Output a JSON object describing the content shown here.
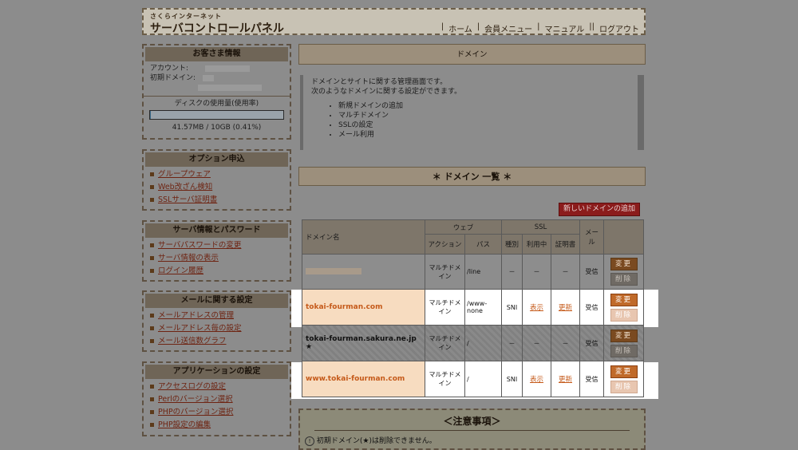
{
  "header": {
    "logo_small": "さくらインターネット",
    "logo_big": "サーバコントロールパネル",
    "nav": [
      "ホーム",
      "会員メニュー",
      "マニュアル",
      "ログアウト"
    ]
  },
  "customer": {
    "title": "お客さま情報",
    "account_label": "アカウント:",
    "domain_label": "初期ドメイン:",
    "disk_title": "ディスクの使用量(使用率)",
    "disk_usage": "41.57MB / 10GB (0.41%)",
    "disk_percent": 0.41
  },
  "options": {
    "title": "オプション申込",
    "items": [
      "グループウェア",
      "Web改ざん検知",
      "SSLサーバ証明書"
    ]
  },
  "server_info": {
    "title": "サーバ情報とパスワード",
    "items": [
      "サーバパスワードの変更",
      "サーバ情報の表示",
      "ログイン履歴"
    ]
  },
  "mail": {
    "title": "メールに関する設定",
    "items": [
      "メールアドレスの管理",
      "メールアドレス毎の設定",
      "メール送信数グラフ"
    ]
  },
  "apps": {
    "title": "アプリケーションの設定",
    "items": [
      "アクセスログの設定",
      "Perlのバージョン選択",
      "PHPのバージョン選択",
      "PHP設定の編集"
    ]
  },
  "main": {
    "section_title": "ドメイン",
    "desc_line1": "ドメインとサイトに関する管理画面です。",
    "desc_line2": "次のようなドメインに関する設定ができます。",
    "features": [
      "新規ドメインの追加",
      "マルチドメイン",
      "SSLの設定",
      "メール利用"
    ],
    "list_title": "＊ ドメイン 一覧 ＊",
    "add_button": "新しいドメインの追加",
    "notice_title": "＜注意事項＞",
    "notice_text": "初期ドメイン(★)は削除できません。"
  },
  "table": {
    "h_domain": "ドメイン名",
    "h_web": "ウェブ",
    "h_ssl": "SSL",
    "h_mail": "メール",
    "h_action": "アクション",
    "h_path": "パス",
    "h_type": "種別",
    "h_use": "利用中",
    "h_cert": "証明書",
    "btn_edit": "変更",
    "btn_del": "削除",
    "rows": [
      {
        "domain": "",
        "action": "マルチドメイン",
        "path": "/line",
        "type": "－",
        "use": "－",
        "cert": "－",
        "mail": "受信"
      },
      {
        "domain": "tokai-fourman.com",
        "action": "マルチドメイン",
        "path": "/www-none",
        "type": "SNI",
        "use": "表示",
        "cert": "更新",
        "mail": "受信"
      },
      {
        "domain": "tokai-fourman.sakura.ne.jp ★",
        "action": "マルチドメイン",
        "path": "/",
        "type": "－",
        "use": "－",
        "cert": "－",
        "mail": "受信"
      },
      {
        "domain": "www.tokai-fourman.com",
        "action": "マルチドメイン",
        "path": "/",
        "type": "SNI",
        "use": "表示",
        "cert": "更新",
        "mail": "受信"
      }
    ]
  }
}
